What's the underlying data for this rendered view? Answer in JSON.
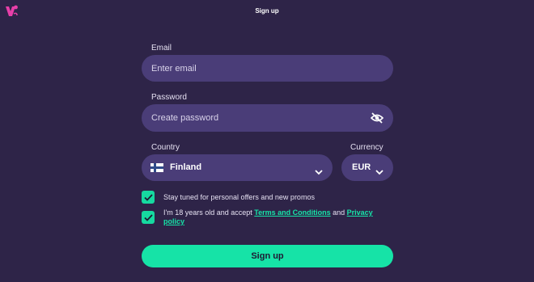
{
  "header": {
    "title": "Sign up",
    "logo_icon": "brand-logo-icon"
  },
  "email": {
    "label": "Email",
    "placeholder": "Enter email"
  },
  "password": {
    "label": "Password",
    "placeholder": "Create password",
    "toggle_icon": "eye-slash-icon"
  },
  "country": {
    "label": "Country",
    "value": "Finland",
    "flag_icon": "finland-flag-icon"
  },
  "currency": {
    "label": "Currency",
    "value": "EUR"
  },
  "consents": {
    "promos": {
      "text": "Stay tuned for personal offers and new promos",
      "checked": true
    },
    "age": {
      "text_before": "I'm 18 years old and accept ",
      "terms_link": "Terms and Conditions",
      "text_middle": " and ",
      "privacy_link": "Privacy policy",
      "checked": true
    }
  },
  "submit": {
    "label": "Sign up"
  },
  "colors": {
    "background": "#2e2448",
    "field": "#4a3d78",
    "accent": "#16e3a7"
  }
}
